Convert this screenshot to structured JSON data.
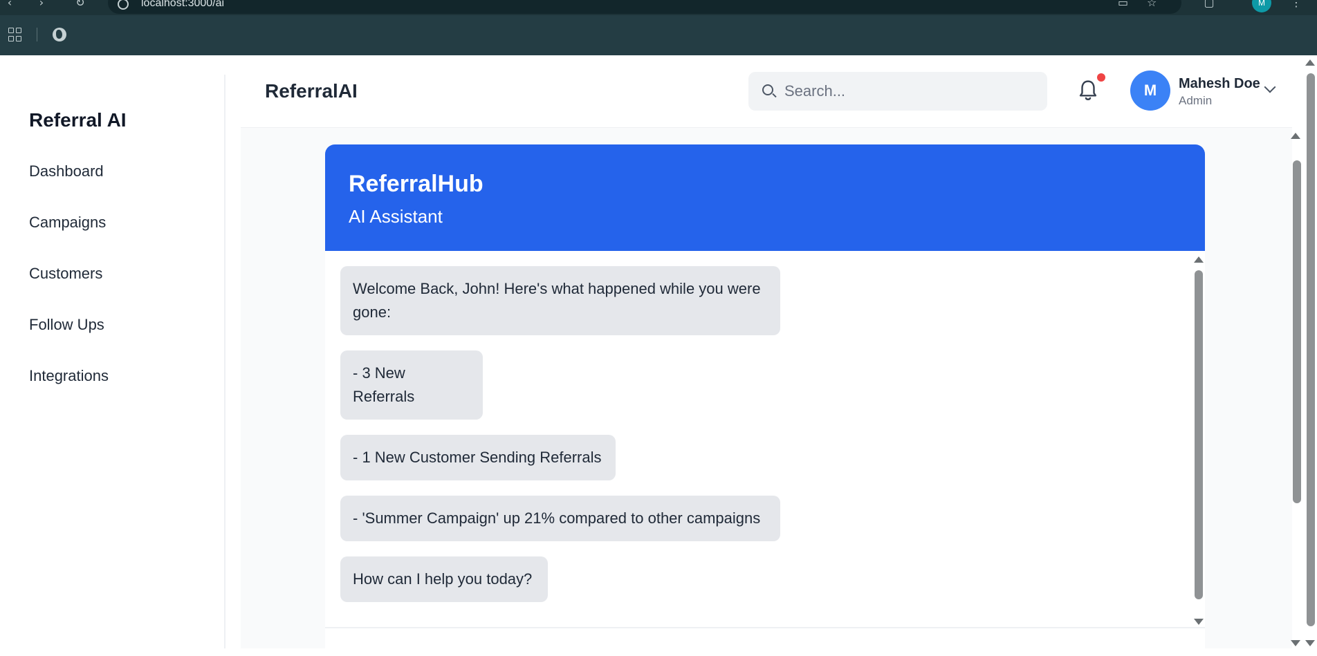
{
  "browser": {
    "url": "localhost:3000/ai",
    "profile_initial": "M"
  },
  "sidebar": {
    "brand": "Referral AI",
    "items": [
      {
        "label": "Dashboard"
      },
      {
        "label": "Campaigns"
      },
      {
        "label": "Customers"
      },
      {
        "label": "Follow Ups"
      },
      {
        "label": "Integrations"
      }
    ]
  },
  "header": {
    "title": "ReferralAI",
    "search_placeholder": "Search...",
    "user": {
      "initial": "M",
      "name": "Mahesh Doe",
      "role": "Admin"
    }
  },
  "chat": {
    "title": "ReferralHub",
    "subtitle": "AI Assistant",
    "messages": [
      {
        "text": "Welcome Back, John! Here's what happened while you were gone:"
      },
      {
        "text": "- 3 New Referrals"
      },
      {
        "text": "- 1 New Customer Sending Referrals"
      },
      {
        "text": "- 'Summer Campaign' up 21% compared to other campaigns"
      },
      {
        "text": "How can I help you today?"
      }
    ]
  },
  "colors": {
    "accent": "#2563eb",
    "avatar": "#3b82f6",
    "notification_dot": "#ef4444",
    "bubble": "#e5e7eb"
  },
  "icons": [
    "back-icon",
    "forward-icon",
    "reload-icon",
    "site-info-icon",
    "screen-icon",
    "star-icon",
    "extensions-icon",
    "menu-icon",
    "apps-icon",
    "globe-icon",
    "search-icon",
    "bell-icon",
    "chevron-down-icon"
  ]
}
